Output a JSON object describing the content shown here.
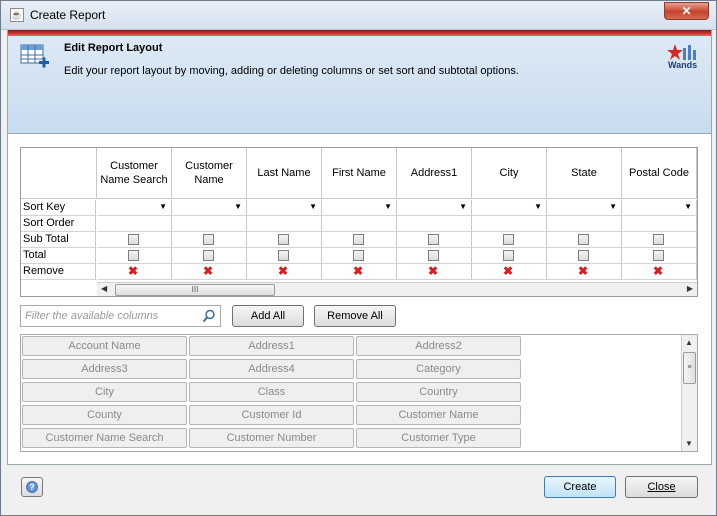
{
  "window": {
    "title": "Create Report",
    "close_label": "✕"
  },
  "banner": {
    "title": "Edit Report Layout",
    "description": "Edit your report layout by moving, adding or deleting columns or set sort and subtotal options.",
    "logo_text": "Wands"
  },
  "grid": {
    "columns": [
      "Customer Name Search",
      "Customer Name",
      "Last Name",
      "First Name",
      "Address1",
      "City",
      "State",
      "Postal Code"
    ],
    "row_labels": [
      "Sort Key",
      "Sort Order",
      "Sub Total",
      "Total",
      "Remove"
    ],
    "scroll_grip": "III"
  },
  "filter": {
    "placeholder": "Filter the available columns"
  },
  "buttons": {
    "add_all": "Add All",
    "remove_all": "Remove All",
    "create": "Create",
    "close": "Close"
  },
  "available_columns": [
    "Account Name",
    "Address1",
    "Address2",
    "Address3",
    "Address4",
    "Category",
    "City",
    "Class",
    "Country",
    "County",
    "Customer Id",
    "Customer Name",
    "Customer Name Search",
    "Customer Number",
    "Customer Type"
  ],
  "colors": {
    "accent_red": "#cc2b2b",
    "banner_bg": "#c8dcef",
    "remove_x": "#d42020"
  }
}
